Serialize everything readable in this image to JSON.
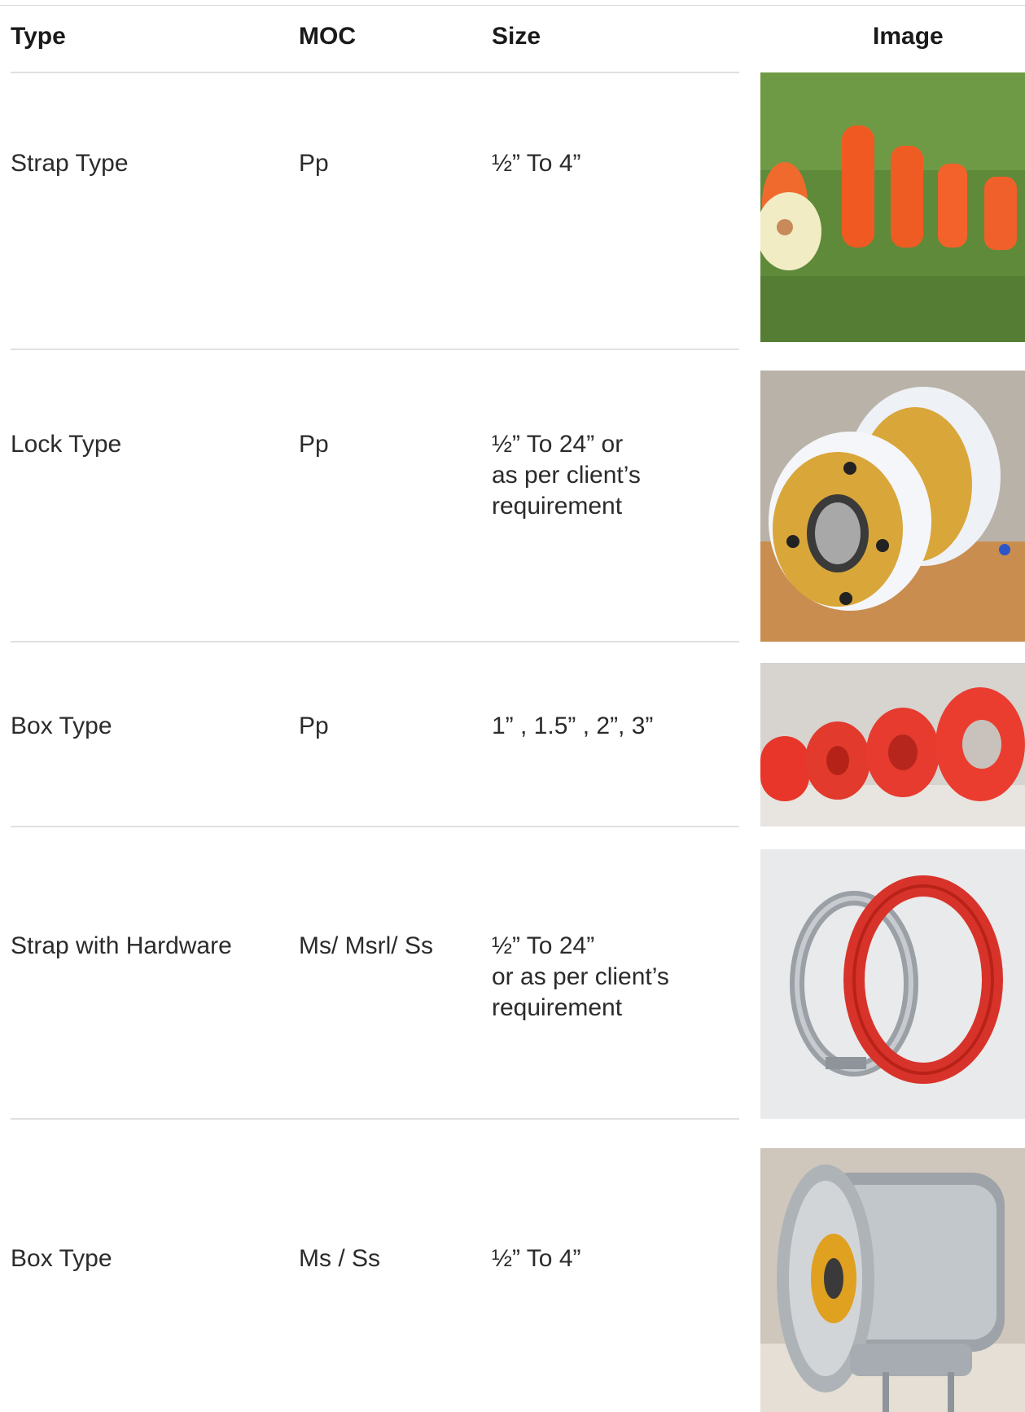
{
  "table": {
    "headers": {
      "type": "Type",
      "moc": "MOC",
      "size": "Size",
      "image": "Image"
    },
    "rows": [
      {
        "type": "Strap Type",
        "moc": "Pp",
        "size": [
          "½” To 4”"
        ],
        "image_icon": "orange-strap-type-clamps-photo"
      },
      {
        "type": "Lock Type",
        "moc": "Pp",
        "size": [
          "½” To 24” or",
          "as per client’s",
          "requirement"
        ],
        "image_icon": "yellow-lock-type-clamp-photo"
      },
      {
        "type": "Box Type",
        "moc": "Pp",
        "size": [
          "1” , 1.5” , 2”, 3”"
        ],
        "image_icon": "red-box-type-clamps-photo"
      },
      {
        "type": "Strap with Hardware",
        "moc": "Ms/ Msrl/ Ss",
        "size": [
          "½” To 24”",
          "or as per client’s",
          "requirement"
        ],
        "image_icon": "metal-and-red-strap-clamp-photo"
      },
      {
        "type": "Box Type",
        "moc": "Ms / Ss",
        "size": [
          "½” To 4”"
        ],
        "image_icon": "stainless-box-type-clamp-photo"
      }
    ]
  }
}
